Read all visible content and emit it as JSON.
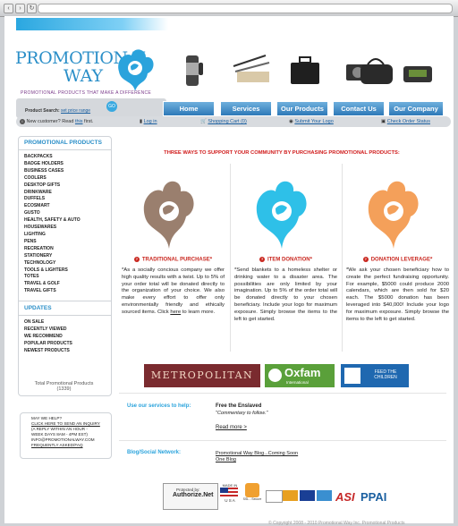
{
  "site": {
    "logo_line1": "PROMOTIONAL",
    "logo_line2": "WAY",
    "tagline": "PROMOTIONAL PRODUCTS THAT MAKE A DIFFERENCE"
  },
  "search": {
    "label": "Product Search:",
    "price_link": "set price range",
    "go_label": "GO"
  },
  "nav": {
    "tabs": [
      "Home",
      "Services",
      "Our Products",
      "Contact Us",
      "Our Company"
    ]
  },
  "infobar": {
    "new_customer_prefix": "New customer? Read",
    "new_customer_link": "this",
    "new_customer_suffix": "first.",
    "login": "Log in",
    "cart": "Shopping Cart (0)",
    "submit_logo": "Submit Your Logo",
    "check_order": "Check Order Status"
  },
  "sidebar": {
    "products_heading": "PROMOTIONAL PRODUCTS",
    "categories": [
      "BACKPACKS",
      "BADGE HOLDERS",
      "BUSINESS CASES",
      "COOLERS",
      "DESKTOP GIFTS",
      "DRINKWARE",
      "DUFFELS",
      "ECOSMART",
      "GUSTO",
      "HEALTH, SAFETY & AUTO",
      "HOUSEWARES",
      "LIGHTING",
      "PENS",
      "RECREATION",
      "STATIONERY",
      "TECHNOLOGY",
      "TOOLS & LIGHTERS",
      "TOTES",
      "TRAVEL & GOLF",
      "TRAVEL GIFTS"
    ],
    "updates_heading": "UPDATES",
    "updates": [
      "ON SALE",
      "RECENTLY VIEWED",
      "WE RECOMMEND",
      "POPULAR PRODUCTS",
      "NEWEST PRODUCTS"
    ],
    "total_label": "Total Promotional Products",
    "total_count": "(1339)"
  },
  "help": {
    "l1": "MAY WE HELP?",
    "l2": "CLICK HERE TO SEND AN INQUIRY",
    "l3": "(A REPLY WITHIN AN HOUR -",
    "l4": "WEEK DAYS 8AM - 4PM EST)",
    "l5": "INFO@PROMOTIONALWAY.COM",
    "l6": "FREQUENTLY ASKED/FAQ"
  },
  "main": {
    "headline": "THREE WAYS TO SUPPORT YOUR COMMUNITY BY PURCHASING PROMOTIONAL PRODUCTS:",
    "columns": [
      {
        "title": "TRADITIONAL PURCHASE*",
        "body": "*As a socially concious company we offer high quality results with a twist. Up to 5% of your order total will be donated directly to the organization of your choice. We also make every effort to offer only environmentally friendly and ethically sourced items. Click",
        "link": "here",
        "tail": "to learn more.",
        "color": "#9a7f6e"
      },
      {
        "title": "ITEM DONATION*",
        "body": "*Send blankets to a homeless shelter or drinking water to a disaster area. The possibilities are only limited by your imagination. Up to 5% of the order total will be donated directly to your chosen beneficiary. Include your logo for maximum exposure. Simply browse the items to the left to get started.",
        "color": "#2ec0e8"
      },
      {
        "title": "DONATION LEVERAGE*",
        "body": "*We ask your chosen beneficiary how to create the perfect fundraising opportunity. For example, $5000 could produce 2000 calendars, which are then sold for $20 each. The $5000 donation has been leveraged into $40,000! Include your logo for maximum exposure. Simply browse the items to the left to get started.",
        "color": "#f4a05a"
      }
    ],
    "partners": [
      "METROPOLITAN",
      "Oxfam",
      "International",
      "FEED THE CHILDREN"
    ],
    "services_label": "Use our services to help:",
    "services_title": "Free the Enslaved",
    "services_quote": "\"Commentary to follow.\"",
    "read_more": "Read more >",
    "blog_label": "Blog/Social Network:",
    "blog_link1": "Promotional Way Blog...Coming Soon",
    "blog_link2": "One Blog"
  },
  "badges": {
    "authorize_line1": "Protected by:",
    "authorize_line2": "Authorize.Net",
    "made_in": "MADE IN",
    "usa": "U S A",
    "ssl": "SSL - Secure",
    "asi": "ASI",
    "ppai": "PPAI"
  },
  "footer": {
    "copyright": "© Copyright 2008 - 2010 Promotional Way Inc. Promotional Products"
  }
}
